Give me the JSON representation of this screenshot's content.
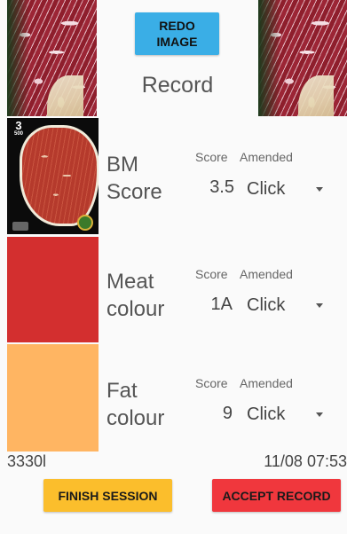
{
  "header": {
    "redo_button": "REDO\nIMAGE",
    "title": "Record"
  },
  "columns": {
    "score": "Score",
    "amended": "Amended"
  },
  "rows": [
    {
      "label_line1": "BM",
      "label_line2": "Score",
      "score": "3.5",
      "amended": "Click"
    },
    {
      "label_line1": "Meat",
      "label_line2": "colour",
      "score": "1A",
      "amended": "Click"
    },
    {
      "label_line1": "Fat",
      "label_line2": "colour",
      "score": "9",
      "amended": "Click"
    }
  ],
  "reference_card": {
    "grade_label": "3",
    "sub_label": "500"
  },
  "swatches": {
    "meat_colour": "#d32f2f",
    "fat_colour": "#ffb562"
  },
  "footer": {
    "id": "3330l",
    "timestamp": "11/08 07:53"
  },
  "actions": {
    "finish_session": "FINISH SESSION",
    "accept_record": "ACCEPT RECORD",
    "finish_color": "#fbbe2c",
    "accept_color": "#f0373d"
  }
}
